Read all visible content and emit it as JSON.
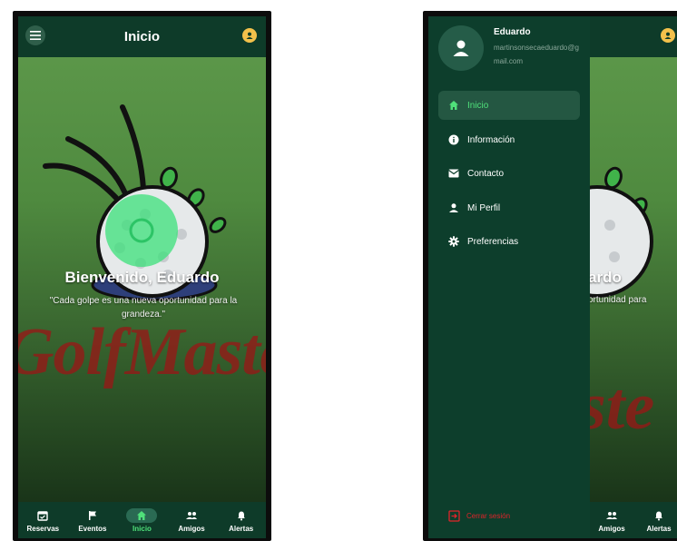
{
  "app": {
    "title": "Inicio",
    "brand": "GolfMaster",
    "welcome": "Bienvenido, Eduardo",
    "quote": "\"Cada golpe es una nueva oportunidad para la grandeza.\"",
    "colors": {
      "bar": "#0e3b29",
      "accent": "#4fe07a",
      "logout": "#e0242a",
      "brand_text": "#9a1616"
    }
  },
  "left_nav": [
    {
      "label": "Reservas",
      "icon": "calendar-check-icon"
    },
    {
      "label": "Eventos",
      "icon": "flag-icon"
    },
    {
      "label": "Inicio",
      "icon": "home-icon",
      "active": true
    },
    {
      "label": "Amigos",
      "icon": "people-icon"
    },
    {
      "label": "Alertas",
      "icon": "bell-icon"
    }
  ],
  "right_visible": {
    "welcome_fragment": "ardo",
    "quote_fragment": "ortunidad para",
    "brand_fragment": "aste",
    "nav": [
      {
        "label": "Amigos",
        "icon": "people-icon"
      },
      {
        "label": "Alertas",
        "icon": "bell-icon"
      }
    ]
  },
  "drawer": {
    "user_name": "Eduardo",
    "email": "martinsonsecaeduardo@gmail.com",
    "items": [
      {
        "label": "Inicio",
        "icon": "home-icon",
        "active": true
      },
      {
        "label": "Información",
        "icon": "info-icon"
      },
      {
        "label": "Contacto",
        "icon": "mail-icon"
      },
      {
        "label": "Mi Perfil",
        "icon": "person-icon"
      },
      {
        "label": "Preferencias",
        "icon": "gear-icon"
      }
    ],
    "logout_label": "Cerrar sesión"
  }
}
